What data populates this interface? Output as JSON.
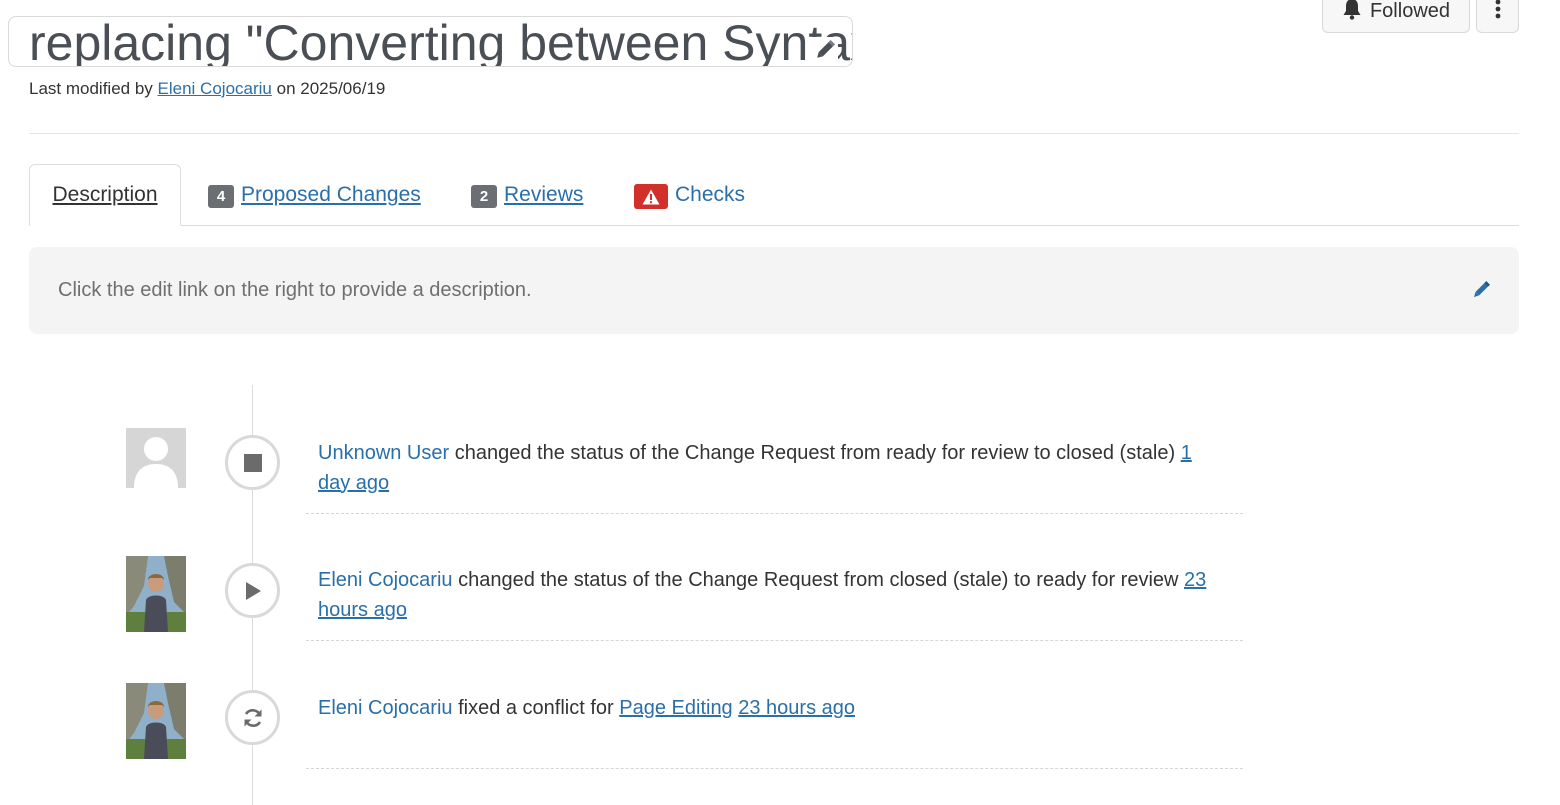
{
  "header": {
    "title": "replacing \"Converting between Syntaxes\"",
    "edit_title_icon": "pencil-icon",
    "last_modified_prefix": "Last modified by",
    "last_modified_user": "Eleni Cojocariu",
    "last_modified_on": "on",
    "last_modified_date": "2025/06/19",
    "follow_icon": "bell-icon",
    "follow_label": "Followed",
    "more_icon": "vertical-ellipsis-icon"
  },
  "tabs": {
    "description": {
      "label": "Description"
    },
    "proposed_changes": {
      "badge": "4",
      "label": " Proposed Changes"
    },
    "reviews": {
      "badge": "2",
      "label": " Reviews"
    },
    "checks": {
      "icon": "warning-icon",
      "label": "Checks"
    }
  },
  "description": {
    "placeholder": "Click the edit link on the right to provide a description.",
    "edit_icon": "pencil-icon"
  },
  "timeline": [
    {
      "avatar": "default-user-avatar",
      "marker_icon": "stop-icon",
      "user": "Unknown User",
      "text": " changed the status of the Change Request from ready for review to closed (stale) ",
      "time": "1 day ago"
    },
    {
      "avatar": "user-photo-avatar",
      "marker_icon": "play-icon",
      "user": "Eleni Cojocariu",
      "text": " changed the status of the Change Request from closed (stale) to ready for review ",
      "time": "23 hours ago"
    },
    {
      "avatar": "user-photo-avatar",
      "marker_icon": "refresh-icon",
      "user": "Eleni Cojocariu",
      "text": " fixed a conflict for ",
      "page": "Page Editing",
      "time": "23 hours ago"
    }
  ],
  "colors": {
    "link": "#2a6fa8",
    "badge": "#6b6f73",
    "alert": "#d2302b",
    "panel": "#f4f4f4"
  }
}
